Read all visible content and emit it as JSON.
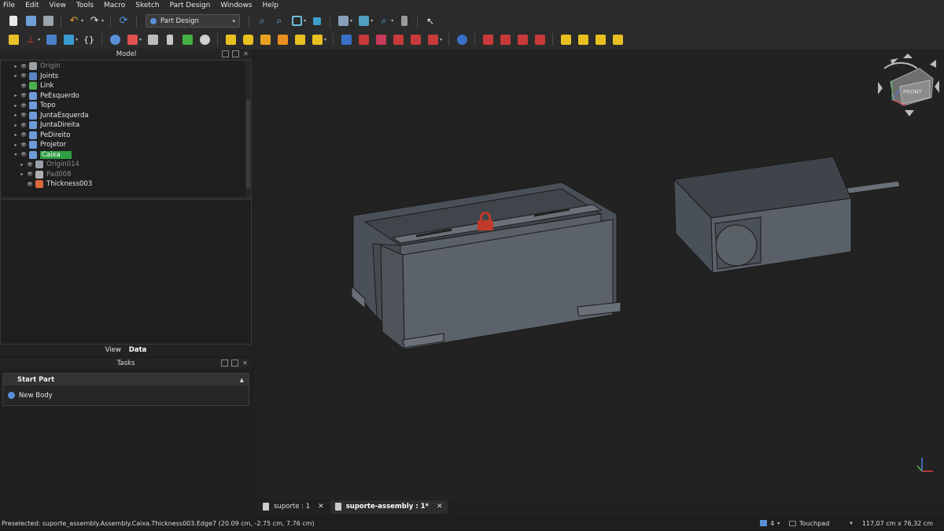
{
  "menu": [
    "File",
    "Edit",
    "View",
    "Tools",
    "Macro",
    "Sketch",
    "Part Design",
    "Windows",
    "Help"
  ],
  "toolbar": {
    "workbench": "Part Design"
  },
  "model_panel": {
    "title": "Model",
    "tree": [
      {
        "label": "Origin",
        "dim": true,
        "arrow": "▸",
        "icon_color": "#9aa0a6"
      },
      {
        "label": "Joints",
        "dim": false,
        "arrow": "▸",
        "icon_color": "#5b86c8"
      },
      {
        "label": "Link",
        "dim": false,
        "arrow": "",
        "icon_color": "#4caf50"
      },
      {
        "label": "PeEsquerdo",
        "dim": false,
        "arrow": "▸",
        "icon_color": "#6e9ad8"
      },
      {
        "label": "Topo",
        "dim": false,
        "arrow": "▸",
        "icon_color": "#6e9ad8"
      },
      {
        "label": "JuntaEsquerda",
        "dim": false,
        "arrow": "▸",
        "icon_color": "#6e9ad8"
      },
      {
        "label": "JuntaDireita",
        "dim": false,
        "arrow": "▸",
        "icon_color": "#6e9ad8"
      },
      {
        "label": "PeDireito",
        "dim": false,
        "arrow": "▸",
        "icon_color": "#6e9ad8"
      },
      {
        "label": "Projetor",
        "dim": false,
        "arrow": "▸",
        "icon_color": "#6e9ad8"
      },
      {
        "label": "Caixa",
        "dim": false,
        "arrow": "▾",
        "icon_color": "#6e9ad8",
        "selected": true
      },
      {
        "label": "Origin014",
        "dim": true,
        "arrow": "▸",
        "icon_color": "#9aa0a6",
        "indent": 1
      },
      {
        "label": "Pad008",
        "dim": true,
        "arrow": "▸",
        "icon_color": "#b0b0b0",
        "indent": 1
      },
      {
        "label": "Thickness003",
        "dim": false,
        "arrow": "",
        "icon_color": "#e0663c",
        "indent": 1
      }
    ]
  },
  "property_tabs": {
    "view": "View",
    "data": "Data"
  },
  "tasks": {
    "title": "Tasks",
    "box_title": "Start Part",
    "item": "New Body"
  },
  "navcube": {
    "face": "FRONT"
  },
  "doc_tabs": [
    {
      "label": "suporte : 1",
      "active": false
    },
    {
      "label": "suporte-assembly : 1*",
      "active": true
    }
  ],
  "status": {
    "preselection": "Preselected: suporte_assembly.Assembly.Caixa.Thickness003.Edge7 (20.09 cm, -2.75 cm, 7.76 cm)",
    "layers": "4",
    "nav_style": "Touchpad",
    "dimensions": "117,07 cm x 76,32 cm"
  },
  "colors": {
    "selection_green": "#2f9e44",
    "model_gray": "#4a5057",
    "lock_red": "#c0392b"
  }
}
